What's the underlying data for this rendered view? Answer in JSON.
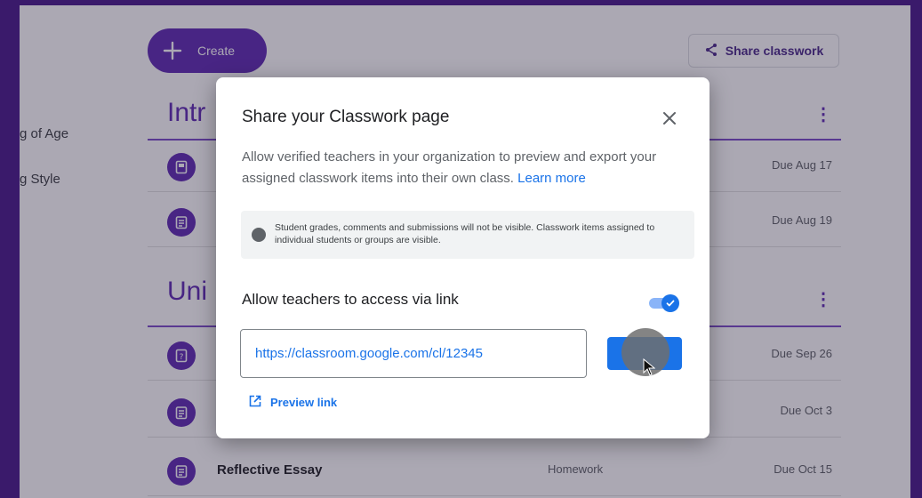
{
  "toolbar": {
    "create_label": "Create",
    "share_label": "Share classwork"
  },
  "sidebar": {
    "items": [
      {
        "label": "g of Age"
      },
      {
        "label": "g Style"
      }
    ]
  },
  "topics": [
    {
      "title": "Intr"
    },
    {
      "title": "Uni"
    }
  ],
  "rows": [
    {
      "title": "",
      "type": "",
      "due": "Due Aug 17",
      "icon": "book-icon"
    },
    {
      "title": "",
      "type": "",
      "due": "Due Aug 19",
      "icon": "assignment-icon"
    },
    {
      "title": "",
      "type": "",
      "due": "Due Sep 26",
      "icon": "question-icon"
    },
    {
      "title": "",
      "type": "",
      "due": "Due Oct 3",
      "icon": "assignment-icon"
    },
    {
      "title": "Reflective Essay",
      "type": "Homework",
      "due": "Due Oct 15",
      "icon": "assignment-icon"
    }
  ],
  "dialog": {
    "title": "Share your Classwork page",
    "description": "Allow verified teachers in your organization to preview and export your assigned classwork items into their own class.",
    "learn_more": "Learn more",
    "notice": "Student grades, comments and submissions will not be visible. Classwork items assigned to individual students or groups are visible.",
    "access_label": "Allow teachers to access via link",
    "toggle_on": true,
    "link_value": "https://classroom.google.com/cl/12345",
    "preview_label": "Preview link"
  },
  "colors": {
    "brand_purple": "#5f2cb3",
    "frame_purple": "#4a1a8c",
    "accent_blue": "#1a73e8"
  }
}
